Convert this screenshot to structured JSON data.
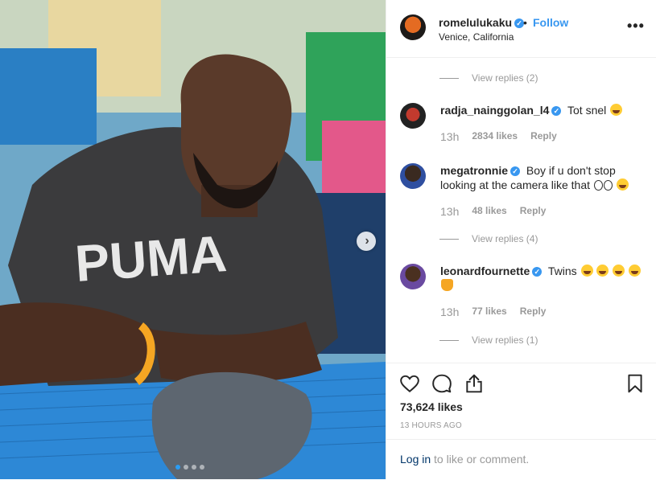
{
  "post": {
    "image_alt": "photo",
    "carousel_dots": 4,
    "active_dot": 0
  },
  "header": {
    "username": "romelulukaku",
    "bullet": "•",
    "follow_label": "Follow",
    "location": "Venice, California",
    "more_label": "•••"
  },
  "comments": {
    "view_replies_1": "View replies (2)",
    "items": [
      {
        "username": "radja_nainggolan_l4",
        "text": "Tot snel",
        "time": "13h",
        "likes": "2834 likes",
        "reply": "Reply"
      },
      {
        "username": "megatronnie",
        "text": "Boy if u don't stop looking at the camera like that",
        "time": "13h",
        "likes": "48 likes",
        "reply": "Reply"
      },
      {
        "username": "leonardfournette",
        "text": "Twins",
        "time": "13h",
        "likes": "77 likes",
        "reply": "Reply"
      }
    ],
    "view_replies_2": "View replies (4)",
    "view_replies_3": "View replies (1)"
  },
  "actions": {
    "likes_count": "73,624 likes",
    "timestamp": "13 HOURS AGO",
    "login_link": "Log in",
    "login_suffix": "to like or comment."
  },
  "colors": {
    "link_blue": "#3897f0",
    "muted": "#999999",
    "text": "#262626"
  }
}
